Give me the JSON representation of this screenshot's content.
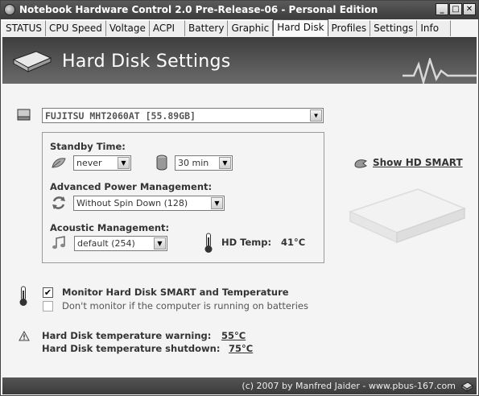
{
  "window": {
    "title": "Notebook Hardware Control 2.0 Pre-Release-06  -  Personal Edition",
    "min_label": "_",
    "max_label": "□",
    "close_label": "✕"
  },
  "tabs": [
    {
      "label": "STATUS"
    },
    {
      "label": "CPU Speed"
    },
    {
      "label": "Voltage"
    },
    {
      "label": "ACPI"
    },
    {
      "label": "Battery"
    },
    {
      "label": "Graphic"
    },
    {
      "label": "Hard Disk"
    },
    {
      "label": "Profiles"
    },
    {
      "label": "Settings"
    },
    {
      "label": "Info"
    }
  ],
  "header": {
    "title": "Hard Disk Settings"
  },
  "drive": {
    "selected": "FUJITSU MHT2060AT  [55.89GB]"
  },
  "standby": {
    "label": "Standby Time:",
    "mode": "never",
    "time": "30 min"
  },
  "apm": {
    "label": "Advanced Power Management:",
    "selected": "Without Spin Down (128)"
  },
  "acoustic": {
    "label": "Acoustic Management:",
    "selected": "default (254)"
  },
  "hd_temp": {
    "label": "HD Temp:",
    "value": "41°C"
  },
  "smart_link": "Show HD SMART",
  "monitor": {
    "smart_label": "Monitor Hard Disk SMART and Temperature",
    "smart_checked": true,
    "battery_label": "Don't monitor if the computer is running on batteries",
    "battery_checked": false
  },
  "temperatures": {
    "warning_label": "Hard Disk temperature warning:",
    "warning_value": "55°C",
    "shutdown_label": "Hard Disk temperature shutdown:",
    "shutdown_value": "75°C"
  },
  "footer": {
    "copyright": "(c) 2007 by Manfred Jaider - www.pbus-167.com"
  },
  "icons": {
    "app": "app-icon",
    "drive": "hard-drive-icon",
    "leaf": "leaf-icon",
    "cylinder": "cylinder-icon",
    "recycle": "power-cycle-icon",
    "music": "music-note-icon",
    "thermometer": "thermometer-icon",
    "warning": "warning-icon",
    "smart": "smart-icon"
  },
  "colors": {
    "header_dark": "#3e3e3e",
    "accent": "#333333"
  }
}
